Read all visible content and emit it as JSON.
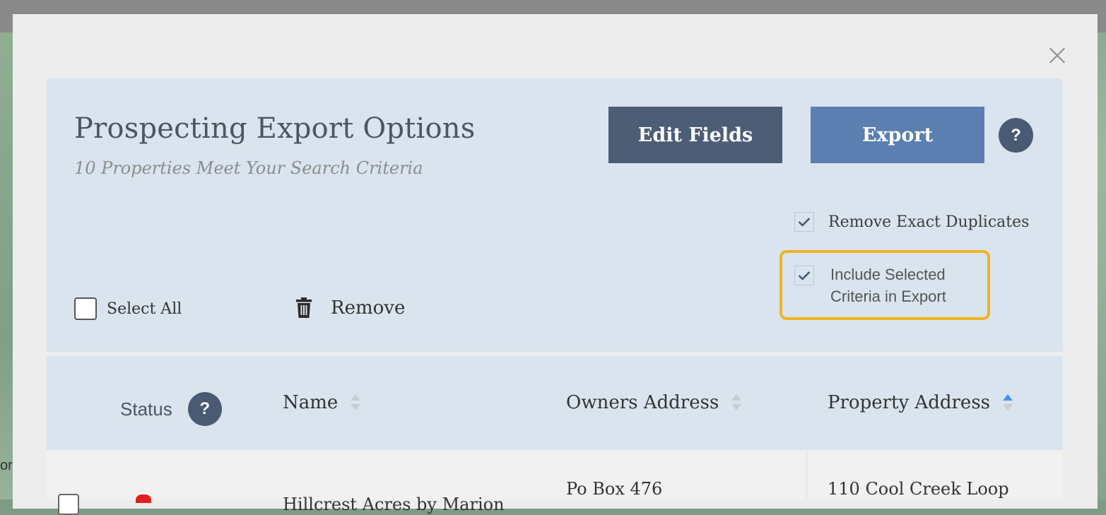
{
  "background": {
    "map_label": "or"
  },
  "modal": {
    "close_label": "close",
    "title": "Prospecting Export Options",
    "subtitle": "10 Properties Meet Your Search Criteria",
    "buttons": {
      "edit_fields": "Edit Fields",
      "export": "Export",
      "help": "?"
    },
    "options": {
      "remove_duplicates": {
        "label": "Remove Exact Duplicates",
        "checked": true
      },
      "include_criteria": {
        "label_line1": "Include Selected",
        "label_line2": "Criteria in Export",
        "checked": true
      }
    },
    "select_all_label": "Select All",
    "remove_label": "Remove",
    "table": {
      "headers": {
        "status": "Status",
        "status_help": "?",
        "name": "Name",
        "owners_address": "Owners Address",
        "property_address": "Property Address"
      },
      "sorted_column": "Property Address",
      "rows": [
        {
          "name": "Hillcrest Acres by Marion",
          "owners_address": "Po Box 476",
          "property_address": "110 Cool Creek Loop"
        }
      ]
    }
  },
  "colors": {
    "panel_bg": "#d9e4ee",
    "edit_button": "#4e5d76",
    "export_button": "#5b7fb0",
    "highlight": "#f0b323",
    "status_icon": "#e02020"
  }
}
